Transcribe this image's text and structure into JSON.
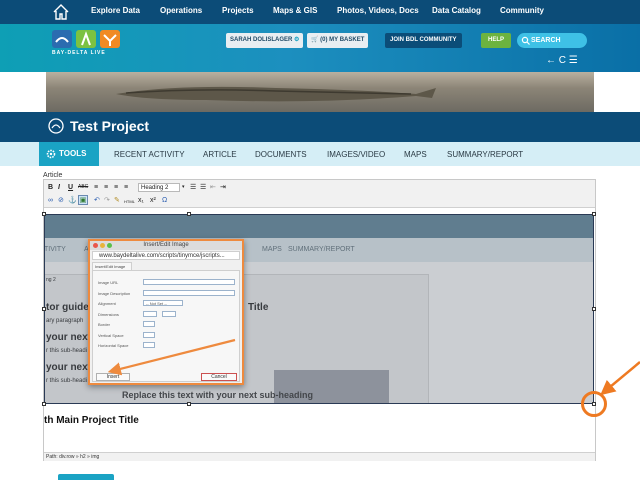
{
  "topnav": {
    "items": [
      "Explore Data",
      "Operations",
      "Projects",
      "Maps & GIS",
      "Photos, Videos, Docs",
      "Data Catalog",
      "Community"
    ]
  },
  "header": {
    "logo_text": "BAY-DELTA LIVE",
    "user": "SARAH DOLISLAGER",
    "basket": "(0) MY BASKET",
    "join": "JOIN BDL COMMUNITY",
    "help": "HELP",
    "search_placeholder": "SEARCH",
    "nav_icons": "← C ☰"
  },
  "project": {
    "title": "Test Project"
  },
  "tabs": {
    "tools": "TOOLS",
    "items": [
      "RECENT ACTIVITY",
      "ARTICLE",
      "DOCUMENTS",
      "IMAGES/VIDEO",
      "MAPS",
      "SUMMARY/REPORT"
    ]
  },
  "editor": {
    "label": "Article",
    "format_select": "Heading 2",
    "path": "Path: div.row » h2 » img",
    "heading_text": "th Main Project Title"
  },
  "embedded": {
    "tabs": [
      "TIVITY",
      "A",
      "MAPS",
      "SUMMARY/REPORT"
    ],
    "texts": {
      "select": "ng 2",
      "guide": "tor guide.",
      "para": "ary paragraph",
      "next1": "your next",
      "sub1": "r this sub-headi",
      "next2": "your next",
      "sub2": "r this sub-headi",
      "title": "Title",
      "replace": "Replace this text with your next sub-heading"
    }
  },
  "dialog": {
    "title": "Insert/Edit Image",
    "url": "www.baydeltalive.com/scripts/tinymce/jscripts...",
    "tab": "Insert/Edit Image",
    "fields": [
      "Image URL",
      "Image Description",
      "Alignment",
      "Dimensions",
      "Border",
      "Vertical Space",
      "Horizontal Space"
    ],
    "alignment_value": "-- Not Set --",
    "insert": "Insert",
    "cancel": "Cancel"
  },
  "colors": {
    "nav_bg": "#0c4c78",
    "accent": "#1aa3c4",
    "annotation": "#ee7a22",
    "help": "#6cb33f"
  }
}
